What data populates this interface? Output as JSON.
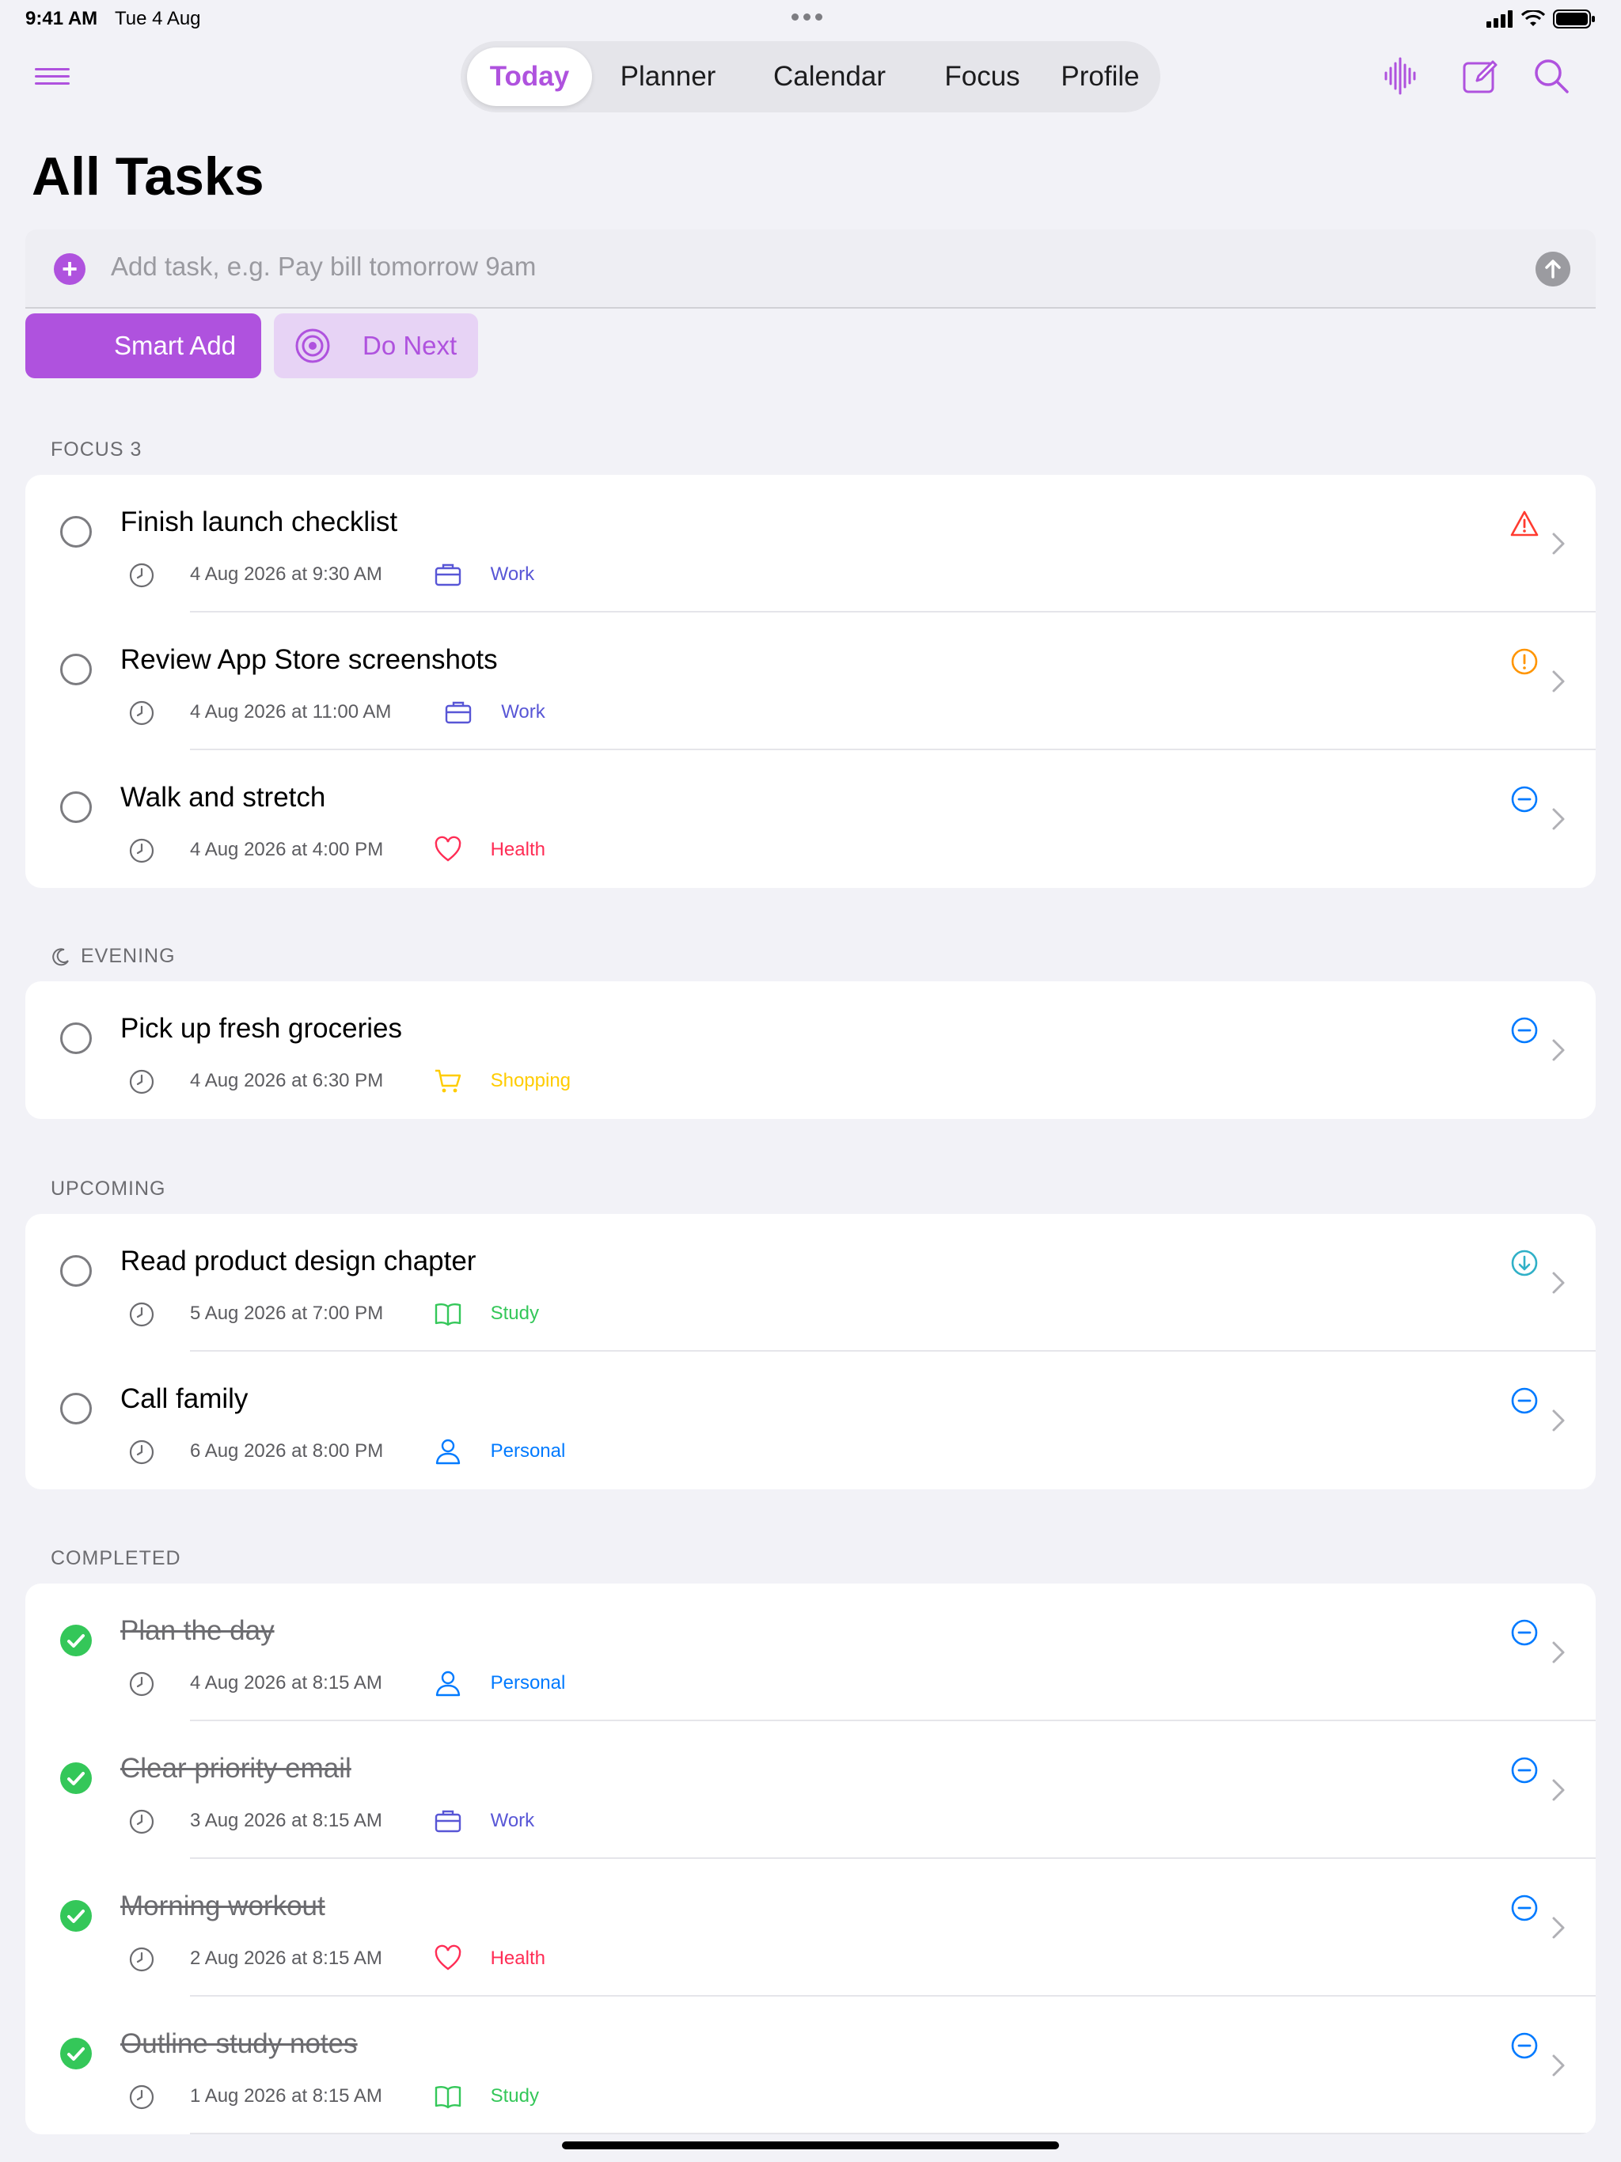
{
  "status_bar": {
    "time": "9:41 AM",
    "date": "Tue 4 Aug"
  },
  "nav": {
    "tabs": [
      {
        "label": "Today",
        "active": true
      },
      {
        "label": "Planner"
      },
      {
        "label": "Calendar"
      },
      {
        "label": "Focus"
      },
      {
        "label": "Profile"
      }
    ],
    "icons": [
      "menu-icon",
      "waveform-icon",
      "compose-icon",
      "search-icon"
    ],
    "accent": "#AF52DE"
  },
  "page_title": "All Tasks",
  "add_task": {
    "placeholder": "Add task, e.g. Pay bill tomorrow 9am"
  },
  "actions": {
    "smart_add": "Smart Add",
    "do_next": "Do Next"
  },
  "sections": {
    "focus": {
      "label": "FOCUS 3",
      "tasks": [
        {
          "title": "Finish launch checklist",
          "date": "4 Aug 2026 at 9:30 AM",
          "category": "Work",
          "priority": "high"
        },
        {
          "title": "Review App Store screenshots",
          "date": "4 Aug 2026 at 11:00 AM",
          "category": "Work",
          "priority": "medium"
        },
        {
          "title": "Walk and stretch",
          "date": "4 Aug 2026 at 4:00 PM",
          "category": "Health",
          "priority": "none"
        }
      ]
    },
    "evening": {
      "label": "EVENING",
      "tasks": [
        {
          "title": "Pick up fresh groceries",
          "date": "4 Aug 2026 at 6:30 PM",
          "category": "Shopping",
          "priority": "none"
        }
      ]
    },
    "upcoming": {
      "label": "UPCOMING",
      "tasks": [
        {
          "title": "Read product design chapter",
          "date": "5 Aug 2026 at 7:00 PM",
          "category": "Study",
          "priority": "low"
        },
        {
          "title": "Call family",
          "date": "6 Aug 2026 at 8:00 PM",
          "category": "Personal",
          "priority": "none"
        }
      ]
    },
    "completed": {
      "label": "COMPLETED",
      "tasks": [
        {
          "title": "Plan the day",
          "date": "4 Aug 2026 at 8:15 AM",
          "category": "Personal",
          "priority": "none"
        },
        {
          "title": "Clear priority email",
          "date": "3 Aug 2026 at 8:15 AM",
          "category": "Work",
          "priority": "none"
        },
        {
          "title": "Morning workout",
          "date": "2 Aug 2026 at 8:15 AM",
          "category": "Health",
          "priority": "none"
        },
        {
          "title": "Outline study notes",
          "date": "1 Aug 2026 at 8:15 AM",
          "category": "Study",
          "priority": "none"
        }
      ]
    }
  },
  "category_colors": {
    "Work": "#5856D6",
    "Health": "#FF2D55",
    "Shopping": "#FFCC00",
    "Study": "#34C759",
    "Personal": "#007AFF"
  },
  "category_icons": {
    "Work": "briefcase-icon",
    "Health": "heart-icon",
    "Shopping": "cart-icon",
    "Study": "book-icon",
    "Personal": "person-icon"
  },
  "priority_colors": {
    "high": "#FF3B30",
    "medium": "#FF9500",
    "low": "#30B0C7",
    "none": "#007AFF"
  }
}
